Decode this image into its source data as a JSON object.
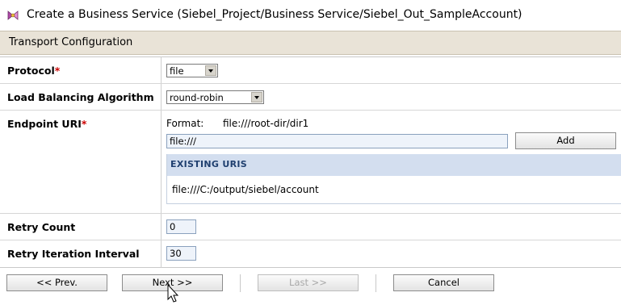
{
  "window": {
    "title": "Create a Business Service (Siebel_Project/Business Service/Siebel_Out_SampleAccount)",
    "icon": "business-service-icon"
  },
  "section": {
    "title": "Transport Configuration"
  },
  "form": {
    "protocol": {
      "label": "Protocol",
      "required_mark": "*",
      "value": "file"
    },
    "load_balancing": {
      "label": "Load Balancing Algorithm",
      "value": "round-robin"
    },
    "endpoint_uri": {
      "label": "Endpoint URI",
      "required_mark": "*",
      "format_label": "Format:",
      "format_value": "file:///root-dir/dir1",
      "input_value": "file:///",
      "add_label": "Add",
      "existing_header": "EXISTING URIS",
      "existing_uris": [
        "file:///C:/output/siebel/account"
      ]
    },
    "retry_count": {
      "label": "Retry Count",
      "value": "0"
    },
    "retry_interval": {
      "label": "Retry Iteration Interval",
      "value": "30"
    }
  },
  "buttons": {
    "prev": "<< Prev.",
    "next": "Next >>",
    "last": "Last >>",
    "cancel": "Cancel"
  },
  "colors": {
    "section_header_bg": "#e9e3d7",
    "uris_header_bg": "#d3deef",
    "required": "#cc0000"
  }
}
